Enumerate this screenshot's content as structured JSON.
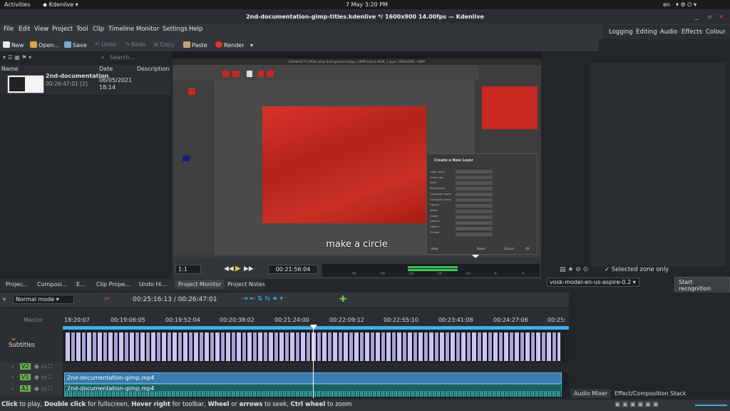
{
  "topbar": {
    "activities": "Activities",
    "app": "Kdenlive",
    "datetime": "7 May  3:20 PM",
    "lang": "en"
  },
  "window": {
    "title": "2nd-documentation-gimp-titles.kdenlive */ 1600x900 14.00fps — Kdenlive"
  },
  "menu": [
    "File",
    "Edit",
    "View",
    "Project",
    "Tool",
    "Clip",
    "Timeline",
    "Monitor",
    "Settings",
    "Help"
  ],
  "workspaces": [
    "Logging",
    "Editing",
    "Audio",
    "Effects",
    "Colour"
  ],
  "toolbar": {
    "new": "New",
    "open": "Open...",
    "save": "Save",
    "undo": "Undo",
    "redo": "Redo",
    "copy": "Copy",
    "paste": "Paste",
    "render": "Render"
  },
  "bin": {
    "search_placeholder": "Search...",
    "columns": [
      "Name",
      "Date",
      "Description"
    ],
    "clip": {
      "name": "2nd-documentation",
      "duration": "00:26:47:01 [2]",
      "date": "06/05/2021",
      "time": "18:14"
    }
  },
  "monitor": {
    "subtitle": "make a circle",
    "zoom": "1:1",
    "timecode": "00:21:56:04",
    "db_marks": [
      "-45",
      "-30",
      "-20",
      "-15",
      "-10",
      "-5",
      "0"
    ],
    "gimp_title": "[Untitled]-7.0 (RGB colour 8-bit gamma integer, GIMP built-in sRGB, 1 layer) 1920x1080 – GIMP",
    "dialog_title": "Create a New Layer",
    "dialog_fields": [
      "Layer name",
      "Colour tag",
      "Mode",
      "Blend space",
      "Composite space",
      "Composite mode",
      "Opacity",
      "Width",
      "Height",
      "Offset X",
      "Offset Y",
      "Fill with"
    ],
    "dialog_buttons": [
      "Help",
      "Reset",
      "Cancel",
      "OK"
    ]
  },
  "bottom_tabs": [
    "Projec...",
    "Composi...",
    "E...",
    "Clip Prope...",
    "Undo Hi...",
    "Project Monitor",
    "Project Notes"
  ],
  "speech": {
    "selected_zone": "Selected zone only",
    "model": "vosk-model-en-us-aspire-0.2",
    "start": "Start recognition"
  },
  "timeline": {
    "mode": "Normal mode",
    "position": "00:25:16:13 / 00:26:47:01",
    "master": "Master",
    "ruler": [
      "18:20:07",
      "00:19:06:05",
      "00:19:52:04",
      "00:20:38:02",
      "00:21:24:00",
      "00:22:09:12",
      "00:22:55:10",
      "00:23:41:08",
      "00:24:27:06",
      "00:25:"
    ],
    "tracks": [
      {
        "label": "Subtitles"
      },
      {
        "label": "V2"
      },
      {
        "label": "V1",
        "clip": "2nd-documentation-gimp.mp4"
      },
      {
        "label": "A1",
        "clip": "2nd-documentation-gimp.mp4"
      }
    ]
  },
  "right_tabs": [
    "Audio Mixer",
    "Effect/Composition Stack"
  ],
  "status": {
    "click": "Click",
    "click_text": " to play, ",
    "dbl": "Double click",
    "dbl_text": " for fullscreen, ",
    "hover": "Hover right",
    "hover_text": " for toolbar, ",
    "wheel": "Wheel",
    "or": " or ",
    "arrows": "arrows",
    "seek": " to seek, ",
    "ctrl": "Ctrl wheel",
    "zoom": " to zoom"
  },
  "colors": {
    "accent": "#3daee9",
    "gimp_red": "#c8281e",
    "track_v": "#3a7cae",
    "track_a": "#2aa198"
  }
}
